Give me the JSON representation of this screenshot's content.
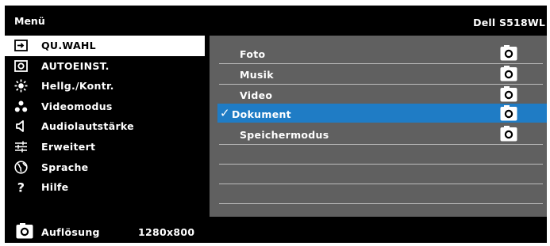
{
  "header": {
    "menu_title": "Menü",
    "model": "Dell S518WL"
  },
  "menu": {
    "items": [
      {
        "label": "QU.WAHL",
        "icon": "source-input-icon",
        "selected": true
      },
      {
        "label": "AUTOEINST.",
        "icon": "auto-adjust-icon",
        "selected": false
      },
      {
        "label": "Hellg./Kontr.",
        "icon": "brightness-sun-icon",
        "selected": false
      },
      {
        "label": "Videomodus",
        "icon": "video-mode-icon",
        "selected": false
      },
      {
        "label": "Audiolautstärke",
        "icon": "speaker-icon",
        "selected": false
      },
      {
        "label": "Erweitert",
        "icon": "sliders-icon",
        "selected": false
      },
      {
        "label": "Sprache",
        "icon": "globe-icon",
        "selected": false
      },
      {
        "label": "Hilfe",
        "icon": "help-question-icon",
        "selected": false
      }
    ]
  },
  "submenu": {
    "items": [
      {
        "label": "Foto",
        "checked": false,
        "selected": false,
        "icon": "camera-icon"
      },
      {
        "label": "Musik",
        "checked": false,
        "selected": false,
        "icon": "camera-icon"
      },
      {
        "label": "Video",
        "checked": false,
        "selected": false,
        "icon": "camera-icon"
      },
      {
        "label": "Dokument",
        "checked": true,
        "selected": true,
        "icon": "camera-icon",
        "check_mark": "✓"
      },
      {
        "label": "Speichermodus",
        "checked": false,
        "selected": false,
        "icon": "camera-icon"
      }
    ]
  },
  "footer": {
    "label": "Auflösung",
    "value": "1280x800",
    "icon": "camera-icon"
  },
  "colors": {
    "background": "#000000",
    "panel": "#606060",
    "selection": "#1f7cc5",
    "highlight": "#ffffff"
  }
}
